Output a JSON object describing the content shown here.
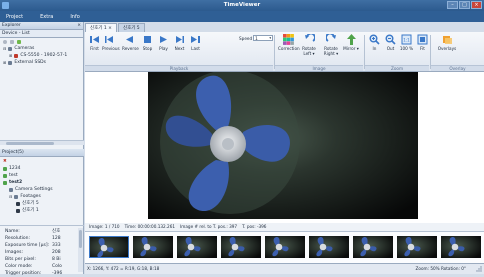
{
  "window": {
    "title": "TimeViewer"
  },
  "menu": [
    "Project",
    "Extra",
    "Info"
  ],
  "explorer": {
    "header": "Explorer",
    "subheader": "Device - List",
    "items": [
      {
        "label": "Cameras"
      },
      {
        "label": "CS-5550 - 1902-57-1"
      },
      {
        "label": "External SSDs"
      }
    ]
  },
  "project": {
    "header": "Project(5)",
    "items": [
      {
        "label": "1234"
      },
      {
        "label": "test"
      },
      {
        "label": "test2"
      },
      {
        "label": "Camera Settings"
      },
      {
        "label": "Footages"
      },
      {
        "label": "신호기 5"
      },
      {
        "label": "신호기 1"
      }
    ]
  },
  "properties": [
    {
      "key": "Name:",
      "value": "신호"
    },
    {
      "key": "Resolution:",
      "value": "128"
    },
    {
      "key": "Exposure time [µs]:",
      "value": "333"
    },
    {
      "key": "Images:",
      "value": "208"
    },
    {
      "key": "Bits per pixel:",
      "value": "8 Bi"
    },
    {
      "key": "Color mode:",
      "value": "Colo"
    },
    {
      "key": "Trigger position:",
      "value": "-396"
    }
  ],
  "tabs": [
    {
      "label": "신호기 1"
    },
    {
      "label": "신호기 5"
    }
  ],
  "tab_close_glyph": "×",
  "ribbon": {
    "playback_buttons": [
      {
        "label": "First",
        "icon": "skip-first-icon"
      },
      {
        "label": "Previous",
        "icon": "step-back-icon"
      },
      {
        "label": "Reverse",
        "icon": "reverse-icon"
      },
      {
        "label": "Stop",
        "icon": "stop-icon"
      },
      {
        "label": "Play",
        "icon": "play-icon"
      },
      {
        "label": "Next",
        "icon": "step-forward-icon"
      },
      {
        "label": "Last",
        "icon": "skip-last-icon"
      }
    ],
    "speed_label": "Speed",
    "speed_value": "1",
    "image_buttons": [
      {
        "label": "Correction",
        "icon": "color-grid-icon"
      },
      {
        "label": "Rotate Left ▾",
        "icon": "rotate-left-icon"
      },
      {
        "label": "Rotate Right ▾",
        "icon": "rotate-right-icon"
      },
      {
        "label": "Mirror ▾",
        "icon": "mirror-icon"
      }
    ],
    "zoom_buttons": [
      {
        "label": "In",
        "icon": "zoom-in-icon"
      },
      {
        "label": "Out",
        "icon": "zoom-out-icon"
      },
      {
        "label": "100 %",
        "icon": "zoom-100-icon"
      },
      {
        "label": "Fit",
        "icon": "zoom-fit-icon"
      }
    ],
    "overlay_buttons": [
      {
        "label": "Overlays",
        "icon": "overlay-icon"
      }
    ],
    "groups": {
      "playback": "Playback",
      "image": "Image",
      "zoom": "Zoom",
      "overlay": "Overlay"
    }
  },
  "frame_info": {
    "image": "Image:  1 / 710",
    "time": "Time:  00:00:00.132.261",
    "rel": "Image # rel. to T. pos.:  397",
    "tpos": "T. pos:  -396"
  },
  "status": {
    "coords": "X: 1266, Y: 472 = R:19, G:18, B:18",
    "zoom": "Zoom: 50%  Rotation: 0°"
  },
  "colors": {
    "titlebar": "#2c5a8e",
    "playback_blue": "#3a78c8",
    "fan_blue": "#3c5fae",
    "fan_hub": "#d8dce0"
  }
}
